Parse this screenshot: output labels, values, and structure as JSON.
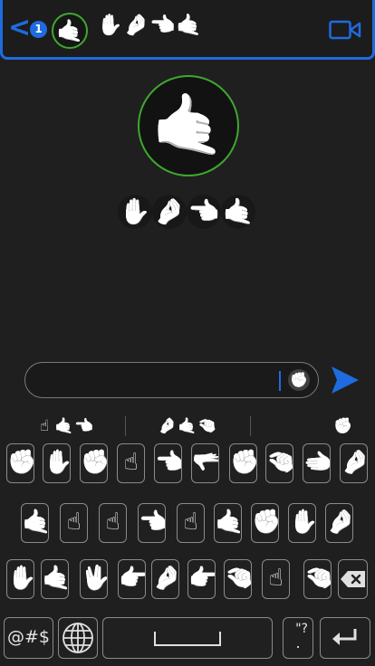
{
  "header": {
    "back_glyph": "<",
    "unread_count": "1",
    "contact_avatar": "🤙",
    "contact_sign_sequence": [
      "✋",
      "🤌",
      "👈",
      "🤙"
    ]
  },
  "profile": {
    "avatar": "🤙",
    "name_sign_sequence": [
      "✋",
      "🤌",
      "👈",
      "🤙"
    ]
  },
  "compose": {
    "input_value": "",
    "input_sign": "✊"
  },
  "suggestions": {
    "left": [
      "☝",
      "🤙",
      "👈"
    ],
    "middle": [
      "🤌",
      "🤙",
      "🤏"
    ],
    "right": [
      "✊"
    ]
  },
  "keyboard": {
    "row1": [
      "✊",
      "✋",
      "✊",
      "☝",
      "👈",
      "🫳",
      "✊",
      "🤏",
      "🫲",
      "🤌"
    ],
    "row2": [
      "🤙",
      "☝",
      "☝",
      "👈",
      "☝",
      "🤙",
      "✊",
      "✋",
      "🤌"
    ],
    "row3": [
      "✋",
      "🤙",
      "🖖",
      "👉",
      "🤌",
      "👉",
      "🤏",
      "☝",
      "🤏"
    ],
    "symbols_label": "@#$",
    "globe_icon": "globe-icon",
    "punct_top": "\"?",
    "punct_bottom": "."
  },
  "colors": {
    "accent_blue": "#1f6be0",
    "avatar_ring_green": "#3ea82e",
    "background": "#1f1f1f"
  }
}
